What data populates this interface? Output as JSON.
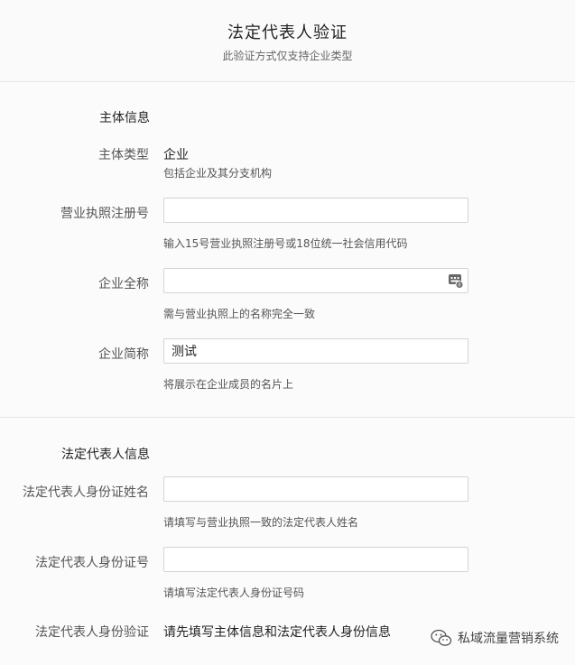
{
  "header": {
    "title": "法定代表人验证",
    "subtitle": "此验证方式仅支持企业类型"
  },
  "entity_section": {
    "heading": "主体信息",
    "type_label": "主体类型",
    "type_value": "企业",
    "type_hint": "包括企业及其分支机构",
    "reg_label": "营业执照注册号",
    "reg_value": "",
    "reg_hint": "输入15号营业执照注册号或18位统一社会信用代码",
    "fullname_label": "企业全称",
    "fullname_value": "",
    "fullname_hint": "需与营业执照上的名称完全一致",
    "fullname_icon": "keyboard-badge-icon",
    "shortname_label": "企业简称",
    "shortname_value": "测试",
    "shortname_hint": "将展示在企业成员的名片上"
  },
  "legal_section": {
    "heading": "法定代表人信息",
    "name_label": "法定代表人身份证姓名",
    "name_value": "",
    "name_hint": "请填写与营业执照一致的法定代表人姓名",
    "id_label": "法定代表人身份证号",
    "id_value": "",
    "id_hint": "请填写法定代表人身份证号码",
    "verify_label": "法定代表人身份验证",
    "verify_value": "请先填写主体信息和法定代表人身份信息"
  },
  "watermark": {
    "text": "私域流量营销系统",
    "icon": "wechat-icon"
  }
}
